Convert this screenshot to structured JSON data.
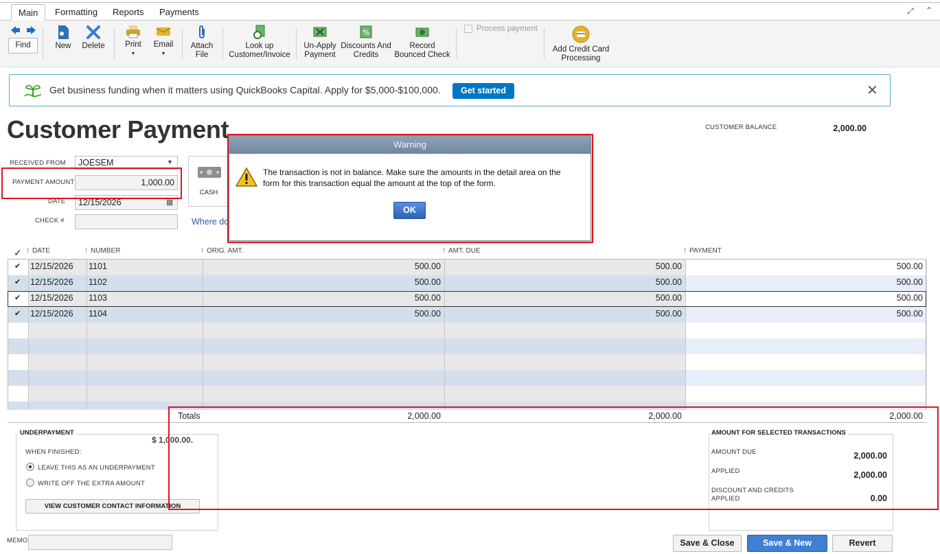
{
  "tabs": [
    "Main",
    "Formatting",
    "Reports",
    "Payments"
  ],
  "toolbar": {
    "find": "Find",
    "new": "New",
    "delete": "Delete",
    "print": "Print",
    "email": "Email",
    "attach_line1": "Attach",
    "attach_line2": "File",
    "lookup_line1": "Look up",
    "lookup_line2": "Customer/Invoice",
    "unapply_line1": "Un-Apply",
    "unapply_line2": "Payment",
    "discounts_line1": "Discounts And",
    "discounts_line2": "Credits",
    "record_line1": "Record",
    "record_line2": "Bounced Check",
    "process_payment": "Process payment",
    "addcc_line1": "Add Credit Card",
    "addcc_line2": "Processing"
  },
  "banner": {
    "text": "Get business funding when it matters using QuickBooks Capital. Apply for $5,000-$100,000.",
    "button": "Get started",
    "close": "✕"
  },
  "page_title": "Customer Payment",
  "customer_balance": {
    "label": "CUSTOMER BALANCE",
    "value": "2,000.00"
  },
  "form": {
    "received_from_label": "RECEIVED FROM",
    "received_from_value": "JOESEM",
    "payment_amount_label": "PAYMENT AMOUNT",
    "payment_amount_value": "1,000.00",
    "date_label": "DATE",
    "date_value": "12/15/2026",
    "check_label": "CHECK #",
    "check_value": "",
    "cash_label": "CASH",
    "where_link": "Where do"
  },
  "grid": {
    "headers": [
      "DATE",
      "NUMBER",
      "ORIG. AMT.",
      "AMT. DUE",
      "PAYMENT"
    ],
    "rows": [
      {
        "date": "12/15/2026",
        "number": "1101",
        "orig": "500.00",
        "due": "500.00",
        "payment": "500.00"
      },
      {
        "date": "12/15/2026",
        "number": "1102",
        "orig": "500.00",
        "due": "500.00",
        "payment": "500.00"
      },
      {
        "date": "12/15/2026",
        "number": "1103",
        "orig": "500.00",
        "due": "500.00",
        "payment": "500.00"
      },
      {
        "date": "12/15/2026",
        "number": "1104",
        "orig": "500.00",
        "due": "500.00",
        "payment": "500.00"
      }
    ],
    "totals_label": "Totals",
    "totals_orig": "2,000.00",
    "totals_due": "2,000.00",
    "totals_payment": "2,000.00"
  },
  "underpayment": {
    "title": "UNDERPAYMENT",
    "amount": "$ 1,000.00.",
    "when_finished": "WHEN FINISHED:",
    "option1": "LEAVE THIS AS AN UNDERPAYMENT",
    "option2": "WRITE OFF THE EXTRA AMOUNT",
    "view_button": "VIEW CUSTOMER CONTACT INFORMATION"
  },
  "summary": {
    "title": "AMOUNT FOR SELECTED TRANSACTIONS",
    "amount_due_label": "AMOUNT DUE",
    "amount_due_value": "2,000.00",
    "applied_label": "APPLIED",
    "applied_value": "2,000.00",
    "discount_label_line1": "DISCOUNT AND CREDITS",
    "discount_label_line2": "APPLIED",
    "discount_value": "0.00"
  },
  "memo_label": "MEMO",
  "buttons": {
    "save_close": "Save & Close",
    "save_new": "Save & New",
    "revert": "Revert"
  },
  "warning": {
    "title": "Warning",
    "message_line1": "The transaction is not in balance. Make sure the amounts in the detail area on the",
    "message_line2": "form for this transaction equal the amount at the top of the form.",
    "ok": "OK"
  },
  "colors": {
    "accent_blue": "#0077c5",
    "annotation_red": "#e0141b",
    "row_blue": "#d4dfee"
  }
}
